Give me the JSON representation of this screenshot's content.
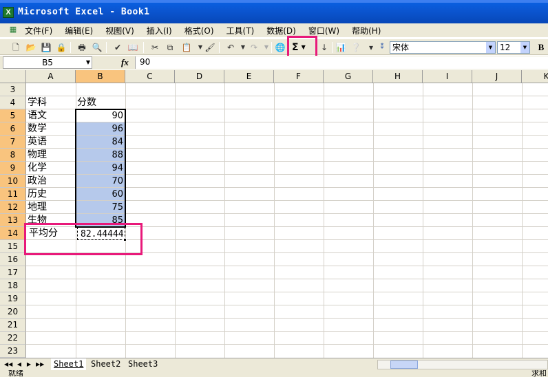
{
  "window": {
    "title": "Microsoft Excel - Book1",
    "app_icon_letter": "X"
  },
  "menu": [
    "文件(F)",
    "编辑(E)",
    "视图(V)",
    "插入(I)",
    "格式(O)",
    "工具(T)",
    "数据(D)",
    "窗口(W)",
    "帮助(H)"
  ],
  "toolbar": {
    "autosum_label": "Σ",
    "font_name": "宋体",
    "font_size": "12",
    "bold_label": "B"
  },
  "formula_bar": {
    "name_box": "B5",
    "fx_label": "fx",
    "value": "90"
  },
  "columns": [
    "A",
    "B",
    "C",
    "D",
    "E",
    "F",
    "G",
    "H",
    "I",
    "J",
    "K"
  ],
  "rows": [
    "3",
    "4",
    "5",
    "6",
    "7",
    "8",
    "9",
    "10",
    "11",
    "12",
    "13",
    "14",
    "15",
    "16",
    "17",
    "18",
    "19",
    "20",
    "21",
    "22",
    "23"
  ],
  "sheet": {
    "header_subject": "学科",
    "header_score": "分数",
    "data": [
      {
        "subject": "语文",
        "score": "90"
      },
      {
        "subject": "数学",
        "score": "96"
      },
      {
        "subject": "英语",
        "score": "84"
      },
      {
        "subject": "物理",
        "score": "88"
      },
      {
        "subject": "化学",
        "score": "94"
      },
      {
        "subject": "政治",
        "score": "70"
      },
      {
        "subject": "历史",
        "score": "60"
      },
      {
        "subject": "地理",
        "score": "75"
      },
      {
        "subject": "生物",
        "score": "85"
      }
    ],
    "avg_label": "平均分",
    "avg_value": "82.44444"
  },
  "tabs": [
    "Sheet1",
    "Sheet2",
    "Sheet3"
  ],
  "status": {
    "left": "就绪",
    "right": "求和"
  }
}
